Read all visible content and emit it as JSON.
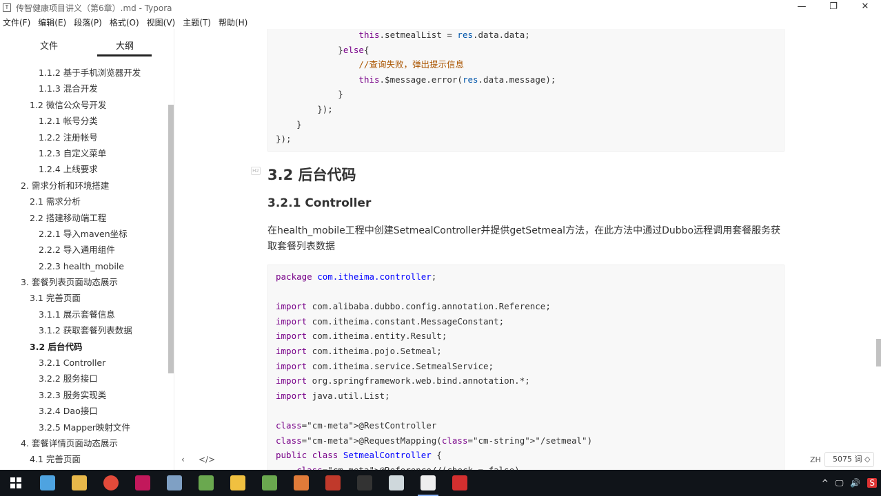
{
  "window": {
    "title": "传智健康项目讲义（第6章）.md - Typora",
    "app_icon": "T",
    "minimize": "—",
    "restore": "❐",
    "close": "✕"
  },
  "menu": [
    "文件(F)",
    "编辑(E)",
    "段落(P)",
    "格式(O)",
    "视图(V)",
    "主题(T)",
    "帮助(H)"
  ],
  "sidebar": {
    "tabs": {
      "files": "文件",
      "outline": "大纲"
    },
    "outline": [
      {
        "level": 3,
        "text": "1.1.2 基于手机浏览器开发"
      },
      {
        "level": 3,
        "text": "1.1.3 混合开发"
      },
      {
        "level": 2,
        "text": "1.2 微信公众号开发"
      },
      {
        "level": 3,
        "text": "1.2.1 帐号分类"
      },
      {
        "level": 3,
        "text": "1.2.2 注册帐号"
      },
      {
        "level": 3,
        "text": "1.2.3 自定义菜单"
      },
      {
        "level": 3,
        "text": "1.2.4 上线要求"
      },
      {
        "level": 1,
        "text": "2. 需求分析和环境搭建"
      },
      {
        "level": 2,
        "text": "2.1 需求分析"
      },
      {
        "level": 2,
        "text": "2.2 搭建移动端工程"
      },
      {
        "level": 3,
        "text": "2.2.1 导入maven坐标"
      },
      {
        "level": 3,
        "text": "2.2.2 导入通用组件"
      },
      {
        "level": 3,
        "text": "2.2.3 health_mobile"
      },
      {
        "level": 1,
        "text": "3. 套餐列表页面动态展示"
      },
      {
        "level": 2,
        "text": "3.1 完善页面"
      },
      {
        "level": 3,
        "text": "3.1.1 展示套餐信息"
      },
      {
        "level": 3,
        "text": "3.1.2 获取套餐列表数据"
      },
      {
        "level": 2,
        "text": "3.2 后台代码",
        "active": true
      },
      {
        "level": 3,
        "text": "3.2.1 Controller"
      },
      {
        "level": 3,
        "text": "3.2.2 服务接口"
      },
      {
        "level": 3,
        "text": "3.2.3 服务实现类"
      },
      {
        "level": 3,
        "text": "3.2.4 Dao接口"
      },
      {
        "level": 3,
        "text": "3.2.5 Mapper映射文件"
      },
      {
        "level": 1,
        "text": "4. 套餐详情页面动态展示"
      },
      {
        "level": 2,
        "text": "4.1 完善页面"
      }
    ],
    "footer_back": "‹",
    "footer_source": "</>"
  },
  "editor": {
    "code_top": [
      "                this.setmealList = res.data.data;",
      "            }else{",
      "                //查询失败，弹出提示信息",
      "                this.$message.error(res.data.message);",
      "            }",
      "        });",
      "    }",
      "});"
    ],
    "heading2": "3.2 后台代码",
    "heading3": "3.2.1 Controller",
    "paragraph": "在health_mobile工程中创建SetmealController并提供getSetmeal方法，在此方法中通过Dubbo远程调用套餐服务获取套餐列表数据",
    "code_bottom": [
      "package com.itheima.controller;",
      "",
      "import com.alibaba.dubbo.config.annotation.Reference;",
      "import com.itheima.constant.MessageConstant;",
      "import com.itheima.entity.Result;",
      "import com.itheima.pojo.Setmeal;",
      "import com.itheima.service.SetmealService;",
      "import org.springframework.web.bind.annotation.*;",
      "import java.util.List;",
      "",
      "@RestController",
      "@RequestMapping(\"/setmeal\")",
      "public class SetmealController {",
      "    @Reference//(check = false)"
    ]
  },
  "status": {
    "lang": "ZH",
    "words": "5075 词 ◇"
  },
  "taskbar": {
    "apps": [
      "explorer-icon",
      "folder-icon",
      "chrome-icon",
      "idea-icon",
      "feather-icon",
      "image-viewer-icon",
      "chat-icon",
      "notepad-icon",
      "matlab-icon",
      "redis-icon",
      "terminal-icon",
      "window-icon",
      "typora-icon",
      "record-icon"
    ],
    "tray": [
      "^",
      "🖵",
      "🔊",
      "S"
    ]
  }
}
